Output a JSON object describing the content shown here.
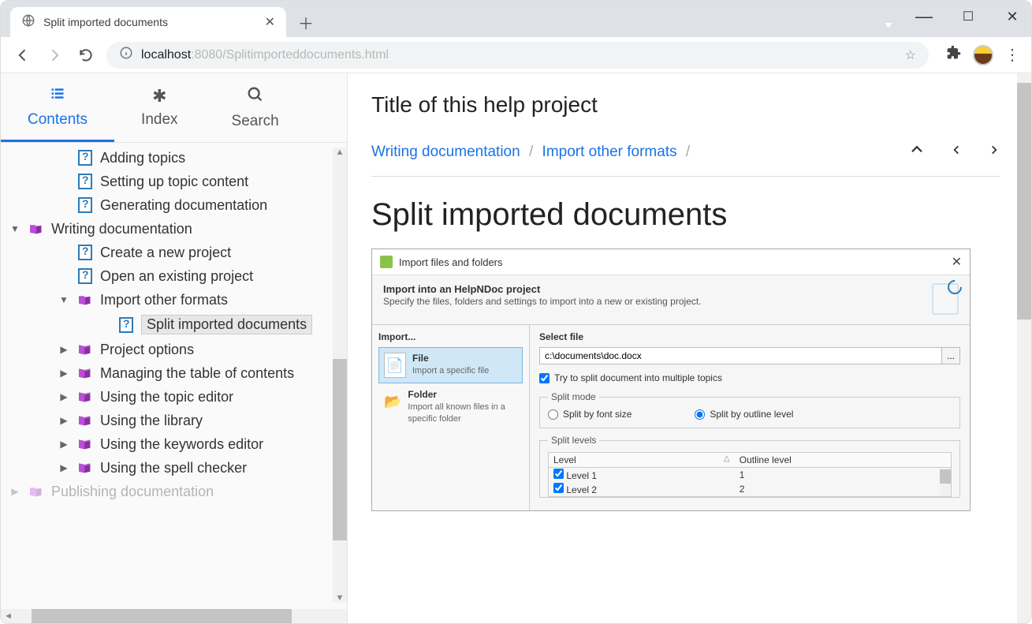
{
  "browser": {
    "tab_title": "Split imported documents",
    "url_host": "localhost",
    "url_port_path": ":8080/Splitimporteddocuments.html"
  },
  "left_tabs": {
    "contents": "Contents",
    "index": "Index",
    "search": "Search"
  },
  "tree": {
    "items": [
      {
        "label": "Adding topics",
        "indent": 2,
        "icon": "q",
        "exp": "none"
      },
      {
        "label": "Setting up topic content",
        "indent": 2,
        "icon": "q",
        "exp": "none"
      },
      {
        "label": "Generating documentation",
        "indent": 2,
        "icon": "q",
        "exp": "none"
      },
      {
        "label": "Writing documentation",
        "indent": 0,
        "icon": "book-open",
        "exp": "down"
      },
      {
        "label": "Create a new project",
        "indent": 2,
        "icon": "q",
        "exp": "none"
      },
      {
        "label": "Open an existing project",
        "indent": 2,
        "icon": "q",
        "exp": "none"
      },
      {
        "label": "Import other formats",
        "indent": 2,
        "icon": "book-open",
        "exp": "down"
      },
      {
        "label": "Split imported documents",
        "indent": 4,
        "icon": "q",
        "exp": "none",
        "selected": true
      },
      {
        "label": "Project options",
        "indent": 2,
        "icon": "book",
        "exp": "right"
      },
      {
        "label": "Managing the table of contents",
        "indent": 2,
        "icon": "book",
        "exp": "right"
      },
      {
        "label": "Using the topic editor",
        "indent": 2,
        "icon": "book",
        "exp": "right"
      },
      {
        "label": "Using the library",
        "indent": 2,
        "icon": "book",
        "exp": "right"
      },
      {
        "label": "Using the keywords editor",
        "indent": 2,
        "icon": "book",
        "exp": "right"
      },
      {
        "label": "Using the spell checker",
        "indent": 2,
        "icon": "book",
        "exp": "right"
      },
      {
        "label": "Publishing documentation",
        "indent": 0,
        "icon": "book-open",
        "exp": "right",
        "faded": true
      }
    ]
  },
  "main": {
    "project_title": "Title of this help project",
    "breadcrumbs": [
      {
        "label": "Writing documentation"
      },
      {
        "label": "Import other formats"
      }
    ],
    "heading": "Split imported documents"
  },
  "dialog": {
    "title": "Import files and folders",
    "head_title": "Import into an HelpNDoc project",
    "head_desc": "Specify the files, folders and settings to import into a new or existing project.",
    "import_label": "Import...",
    "options": [
      {
        "name": "File",
        "desc": "Import a specific file",
        "selected": true
      },
      {
        "name": "Folder",
        "desc": "Import all known files in a specific folder",
        "selected": false
      }
    ],
    "select_file_label": "Select file",
    "file_path": "c:\\documents\\doc.docx",
    "browse": "...",
    "try_split": "Try to split document into multiple topics",
    "split_mode_label": "Split mode",
    "split_by_font": "Split by font size",
    "split_by_outline": "Split by outline level",
    "split_levels_label": "Split levels",
    "level_col": "Level",
    "outline_col": "Outline level",
    "levels": [
      {
        "name": "Level 1",
        "outline": "1"
      },
      {
        "name": "Level 2",
        "outline": "2"
      }
    ]
  }
}
